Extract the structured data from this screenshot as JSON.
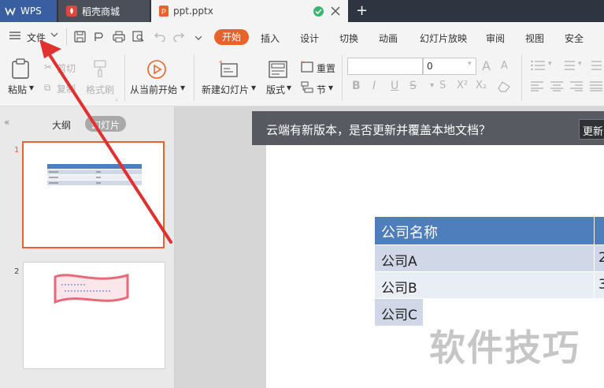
{
  "tabs": [
    {
      "label": "WPS"
    },
    {
      "label": "稻壳商城"
    },
    {
      "label": "ppt.pptx"
    }
  ],
  "menu": {
    "file_label": "文件",
    "items": [
      "开始",
      "插入",
      "设计",
      "切换",
      "动画",
      "幻灯片放映",
      "审阅",
      "视图",
      "安全"
    ]
  },
  "ribbon": {
    "paste": "粘贴",
    "cut": "剪切",
    "copy": "复制",
    "format_painter": "格式刷",
    "from_current": "从当前开始",
    "new_slide": "新建幻灯片",
    "layout": "版式",
    "reset": "重置",
    "section": "节",
    "font_size": "0"
  },
  "left_panel": {
    "outline_tab": "大纲",
    "slides_tab": "幻灯片",
    "slide_numbers": [
      "1",
      "2"
    ]
  },
  "notice": {
    "text": "云端有新版本，是否更新并覆盖本地文档？",
    "button": "更新"
  },
  "slide": {
    "table": {
      "header": "公司名称",
      "rows": [
        "公司A",
        "公司B",
        "公司C"
      ],
      "partial_values": [
        "2",
        "3"
      ]
    },
    "watermark": "软件技巧"
  },
  "colors": {
    "accent": "#e8632c",
    "table_header": "#4f7ebc",
    "table_row_a": "#d0d8e8",
    "table_row_b": "#e9edf4",
    "annotation_arrow": "#e03030"
  }
}
